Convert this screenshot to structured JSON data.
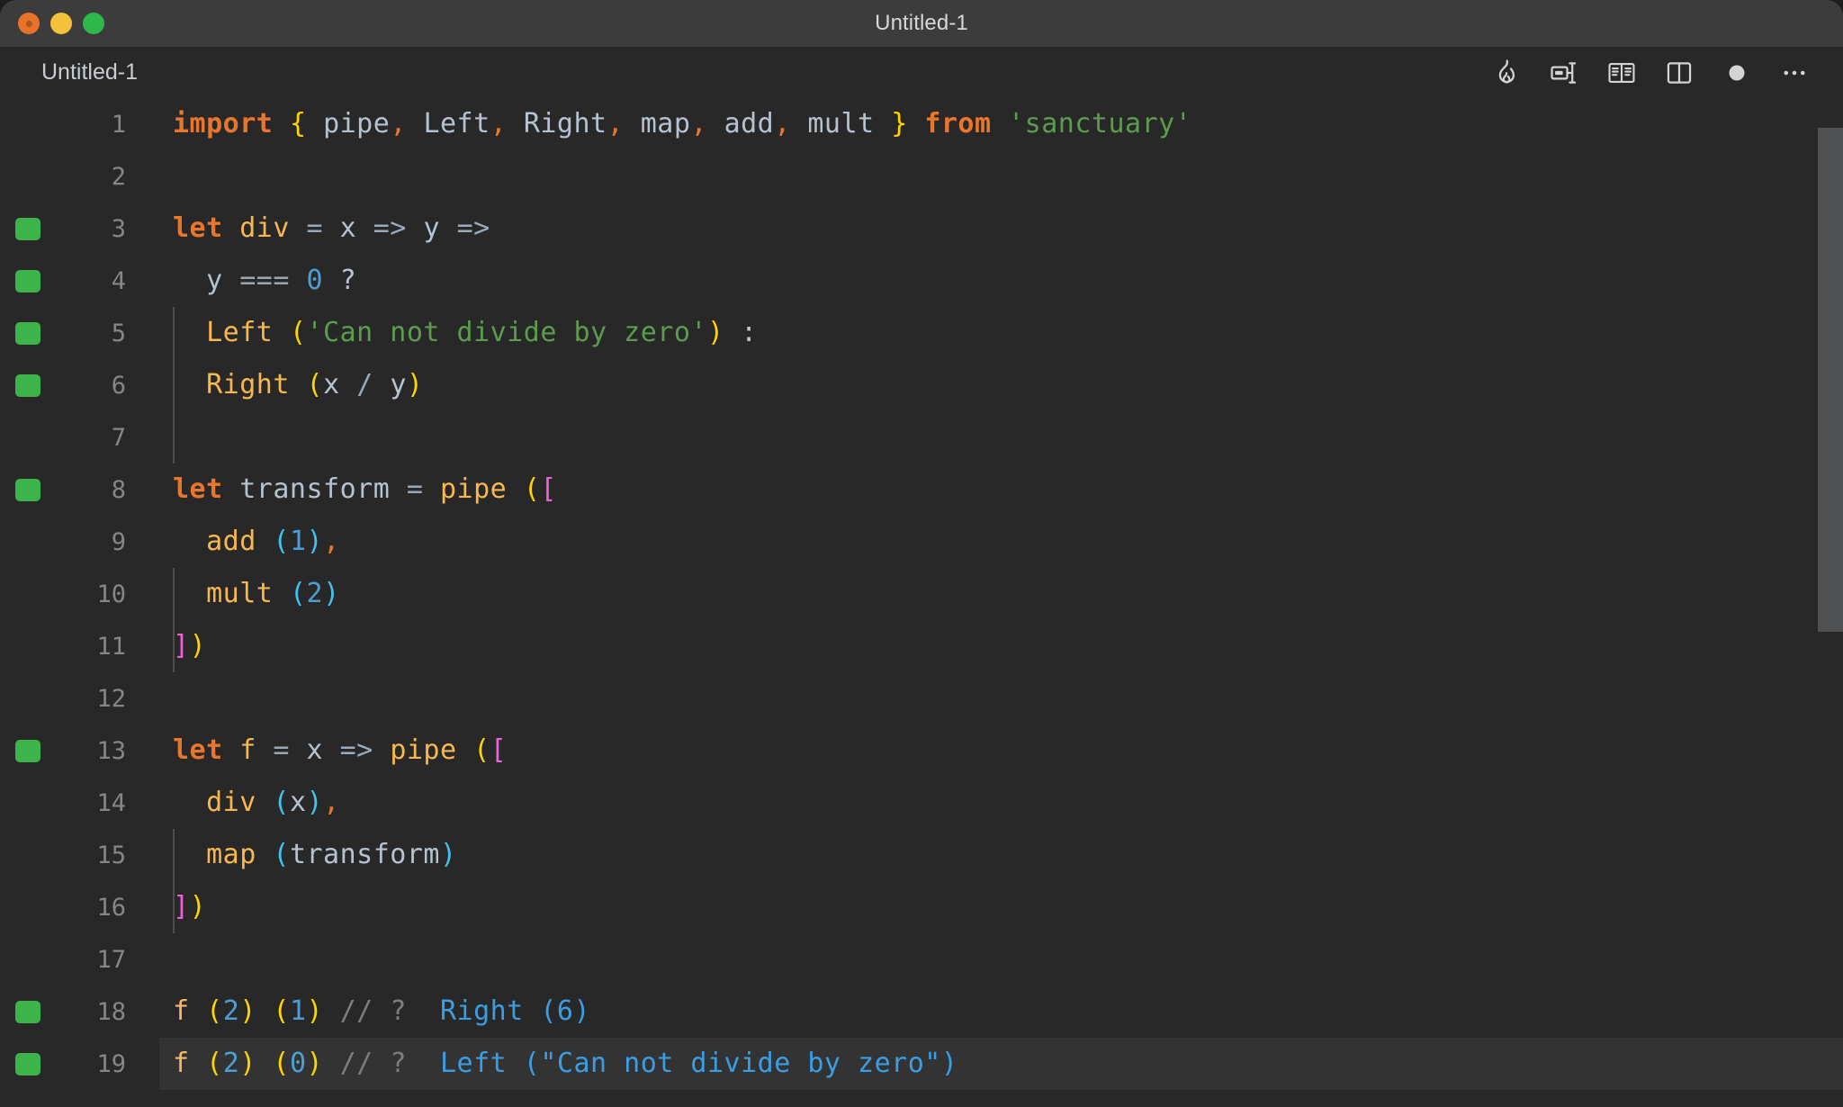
{
  "window": {
    "title": "Untitled-1",
    "traffic_lights": [
      "close",
      "minimize",
      "zoom"
    ]
  },
  "tabbar": {
    "tab_label": "Untitled-1",
    "actions": [
      {
        "name": "run-flame-icon",
        "label": "Run"
      },
      {
        "name": "split-editor-icon",
        "label": "Split Editor"
      },
      {
        "name": "open-book-icon",
        "label": "Open Preview"
      },
      {
        "name": "toggle-panel-icon",
        "label": "Toggle Panel"
      },
      {
        "name": "unsaved-dot-icon",
        "label": "Unsaved"
      },
      {
        "name": "more-actions-icon",
        "label": "More Actions..."
      }
    ]
  },
  "editor": {
    "language": "javascript",
    "lines": [
      {
        "n": "1",
        "marker": false,
        "current": false
      },
      {
        "n": "2",
        "marker": false,
        "current": false
      },
      {
        "n": "3",
        "marker": true,
        "current": false
      },
      {
        "n": "4",
        "marker": true,
        "current": false
      },
      {
        "n": "5",
        "marker": true,
        "current": false
      },
      {
        "n": "6",
        "marker": true,
        "current": false
      },
      {
        "n": "7",
        "marker": false,
        "current": false
      },
      {
        "n": "8",
        "marker": true,
        "current": false
      },
      {
        "n": "9",
        "marker": false,
        "current": false
      },
      {
        "n": "10",
        "marker": false,
        "current": false
      },
      {
        "n": "11",
        "marker": false,
        "current": false
      },
      {
        "n": "12",
        "marker": false,
        "current": false
      },
      {
        "n": "13",
        "marker": true,
        "current": false
      },
      {
        "n": "14",
        "marker": false,
        "current": false
      },
      {
        "n": "15",
        "marker": false,
        "current": false
      },
      {
        "n": "16",
        "marker": false,
        "current": false
      },
      {
        "n": "17",
        "marker": false,
        "current": false
      },
      {
        "n": "18",
        "marker": true,
        "current": false
      },
      {
        "n": "19",
        "marker": true,
        "current": true
      }
    ],
    "source_text": [
      "import { pipe, Left, Right, map, add, mult } from 'sanctuary'",
      "",
      "let div = x => y =>",
      "  y === 0 ?",
      "  Left ('Can not divide by zero') :",
      "  Right (x / y)",
      "",
      "let transform = pipe ([",
      "  add (1),",
      "  mult (2)",
      "])",
      "",
      "let f = x => pipe ([",
      "  div (x),",
      "  map (transform)",
      "])",
      "",
      "f (2) (1) // ?  Right (6)",
      "f (2) (0) // ?  Left (\"Can not divide by zero\")"
    ],
    "tokens": {
      "l1": {
        "kw_import": "import",
        "brace_open": "{",
        "pipe": "pipe",
        "c1": ",",
        "left": "Left",
        "c2": ",",
        "right": "Right",
        "c3": ",",
        "map": "map",
        "c4": ",",
        "add": "add",
        "c5": ",",
        "mult": "mult",
        "brace_close": "}",
        "kw_from": "from",
        "module": "'sanctuary'"
      },
      "l3": {
        "kw": "let",
        "name": "div",
        "eq": "=",
        "x": "x",
        "arrow1": "=>",
        "y": "y",
        "arrow2": "=>"
      },
      "l4": {
        "y": "y",
        "eq3": "===",
        "zero": "0",
        "q": "?"
      },
      "l5": {
        "left": "Left",
        "paren_open": "(",
        "str": "'Can not divide by zero'",
        "paren_close": ")",
        "colon": ":"
      },
      "l6": {
        "right": "Right",
        "paren_open": "(",
        "x": "x",
        "slash": "/",
        "y": "y",
        "paren_close": ")"
      },
      "l8": {
        "kw": "let",
        "name": "transform",
        "eq": "=",
        "pipe": "pipe",
        "paren_open": "(",
        "brkt_open": "["
      },
      "l9": {
        "add": "add",
        "paren_open": "(",
        "num": "1",
        "paren_close": ")",
        "comma": ","
      },
      "l10": {
        "mult": "mult",
        "paren_open": "(",
        "num": "2",
        "paren_close": ")"
      },
      "l11": {
        "brkt_close": "]",
        "paren_close": ")"
      },
      "l13": {
        "kw": "let",
        "name": "f",
        "eq": "=",
        "x": "x",
        "arrow": "=>",
        "pipe": "pipe",
        "paren_open": "(",
        "brkt_open": "["
      },
      "l14": {
        "div": "div",
        "paren_open": "(",
        "x": "x",
        "paren_close": ")",
        "comma": ","
      },
      "l15": {
        "map": "map",
        "paren_open": "(",
        "transform": "transform",
        "paren_close": ")"
      },
      "l16": {
        "brkt_close": "]",
        "paren_close": ")"
      },
      "l18": {
        "f": "f",
        "p1o": "(",
        "n2": "2",
        "p1c": ")",
        "p2o": "(",
        "n1": "1",
        "p2c": ")",
        "slashes": "//",
        "q": "?",
        "result": "Right (6)"
      },
      "l19": {
        "f": "f",
        "p1o": "(",
        "n2": "2",
        "p1c": ")",
        "p2o": "(",
        "n0": "0",
        "p2c": ")",
        "slashes": "//",
        "q": "?",
        "result": "Left (\"Can not divide by zero\")"
      }
    }
  },
  "colors": {
    "editor_background": "#282828",
    "titlebar_background": "#3c3c3c",
    "gutter_marker_green": "#3cb44a",
    "keyword_orange": "#e8762c",
    "function_gold": "#f8b84e",
    "string_green": "#5b9c4f",
    "number_blue": "#4b9fd5",
    "bracket_yellow": "#ffd500",
    "bracket_magenta": "#ef5fd8",
    "bracket_cyan": "#41c3f0",
    "comment_gray": "#7d7d7d",
    "inline_value_blue": "#3b9ee5",
    "linenumber_gray": "#868686",
    "text_default": "#b6c2cf"
  },
  "scrollbar": {
    "orientation": "vertical",
    "visible": true
  }
}
